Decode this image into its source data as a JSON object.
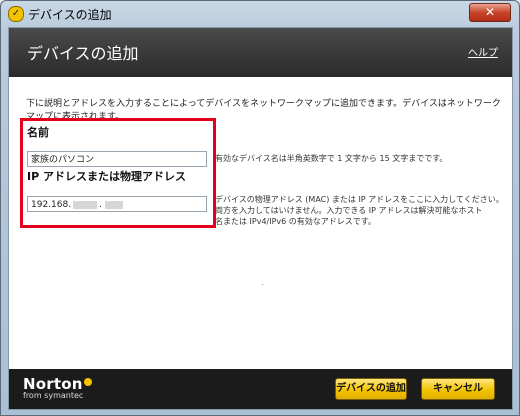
{
  "window": {
    "title": "デバイスの追加",
    "close_label": "✕"
  },
  "header": {
    "title": "デバイスの追加",
    "help_label": "ヘルプ"
  },
  "intro": "下に説明とアドレスを入力することによってデバイスをネットワークマップに追加できます。デバイスはネットワークマップに表示されます。",
  "name_section": {
    "label": "名前",
    "value": "家族のパソコン",
    "hint": "有効なデバイス名は半角英数字で 1 文字から 15 文字までです。"
  },
  "address_section": {
    "label": "IP アドレスまたは物理アドレス",
    "value_prefix": "192.168.",
    "value_separator": ".",
    "hint_lines": [
      "デバイスの物理アドレス (MAC) または IP アドレスをここに入力してください。",
      "両方を入力してはいけません。入力できる IP アドレスは解決可能なホスト",
      "名または IPv4/IPv6 の有効なアドレスです。"
    ]
  },
  "footer": {
    "logo": "Norton",
    "logo_sub": "from symantec",
    "add_button": "デバイスの追加",
    "cancel_button": "キャンセル"
  },
  "colors": {
    "highlight": "#e4001b",
    "button": "#f3c400",
    "header": "#2b2b2b"
  },
  "icons": {
    "app": "norton-check-icon",
    "close": "close-icon"
  }
}
